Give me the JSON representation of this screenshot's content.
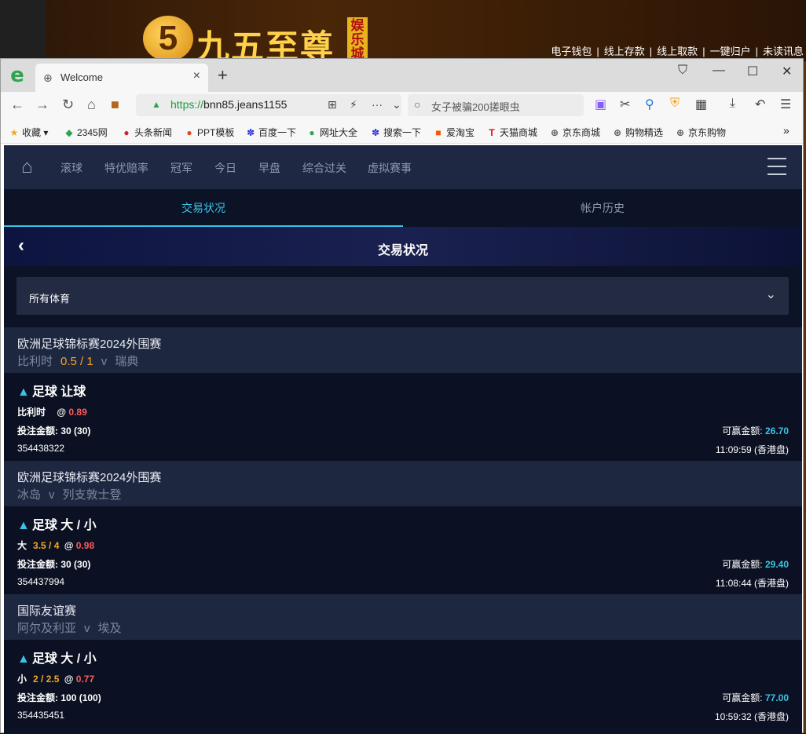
{
  "background": {
    "logo_char": "5",
    "title": "九五至尊",
    "tag": "娱乐城",
    "top_links": [
      "电子钱包",
      "|",
      "线上存款",
      "|",
      "线上取款",
      "|",
      "一键归户",
      "|",
      "未读讯息"
    ]
  },
  "browser": {
    "tab_title": "Welcome",
    "url_scheme": "https://",
    "url_rest": "bnn85.jeans1155",
    "search_text": "女子被骗200搓眼虫",
    "bookmarks": [
      "收藏",
      "2345网",
      "头条新闻",
      "PPT模板",
      "百度一下",
      "网址大全",
      "搜索一下",
      "爱淘宝",
      "天猫商城",
      "京东商城",
      "购物精选",
      "京东购物"
    ]
  },
  "app": {
    "nav": [
      "滚球",
      "特优赔率",
      "冠军",
      "今日",
      "早盘",
      "综合过关",
      "虚拟赛事"
    ],
    "tabs": {
      "active": "交易状况",
      "inactive": "帐户历史"
    },
    "hero_title": "交易状况",
    "filter_label": "所有体育",
    "bets": [
      {
        "league": "欧洲足球锦标赛2024外围赛",
        "home": "比利时",
        "handicap": "0.5 / 1",
        "vs": "v",
        "away": "瑞典",
        "bet_type": "足球 让球",
        "selection": "比利时",
        "line": "",
        "at": "@",
        "odds": "0.89",
        "stake_label": "投注金额:",
        "stake": "30 (30)",
        "win_label": "可赢金额:",
        "win": "26.70",
        "id": "354438322",
        "time": "11:09:59 (香港盘)"
      },
      {
        "league": "欧洲足球锦标赛2024外围赛",
        "home": "冰岛",
        "handicap": "",
        "vs": "v",
        "away": "列支敦士登",
        "bet_type": "足球 大 / 小",
        "selection": "大",
        "line": "3.5 / 4",
        "at": "@",
        "odds": "0.98",
        "stake_label": "投注金额:",
        "stake": "30 (30)",
        "win_label": "可赢金额:",
        "win": "29.40",
        "id": "354437994",
        "time": "11:08:44 (香港盘)"
      },
      {
        "league": "国际友谊赛",
        "home": "阿尔及利亚",
        "handicap": "",
        "vs": "v",
        "away": "埃及",
        "bet_type": "足球 大 / 小",
        "selection": "小",
        "line": "2 / 2.5",
        "at": "@",
        "odds": "0.77",
        "stake_label": "投注金额:",
        "stake": "100 (100)",
        "win_label": "可赢金额:",
        "win": "77.00",
        "id": "354435451",
        "time": "10:59:32 (香港盘)"
      }
    ]
  }
}
